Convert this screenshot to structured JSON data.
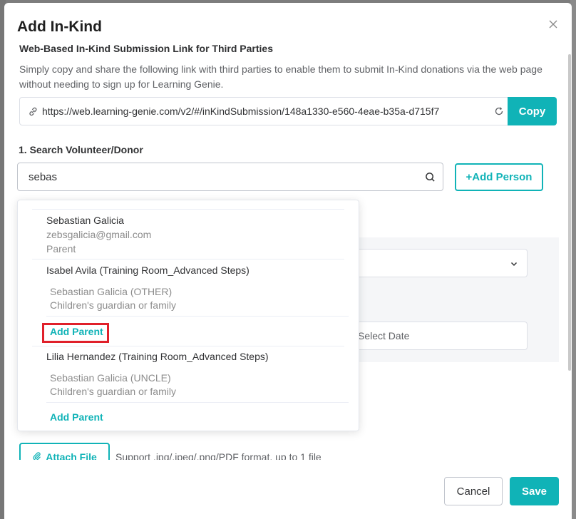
{
  "dialog": {
    "title": "Add In-Kind",
    "close_icon": "close-icon"
  },
  "link_section": {
    "title": "Web-Based In-Kind Submission Link for Third Parties",
    "description": "Simply copy and share the following link with third parties to enable them to submit In-Kind donations via the web page without needing to sign up for Learning Genie.",
    "url": "https://web.learning-genie.com/v2/#/inKindSubmission/148a1330-e560-4eae-b35a-d715f7",
    "copy_label": "Copy"
  },
  "search": {
    "label": "1. Search Volunteer/Donor",
    "value": "sebas",
    "add_person_label": "+Add Person"
  },
  "dropdown": {
    "results": [
      {
        "name": "Sebastian Galicia",
        "email": "zebsgalicia@gmail.com",
        "role": "Parent"
      },
      {
        "name": "Isabel Avila (Training Room_Advanced Steps)",
        "guardian_name": "Sebastian Galicia (OTHER)",
        "guardian_role": "Children's guardian or family",
        "add_parent_label": "Add Parent"
      },
      {
        "name": "Lilia Hernandez (Training Room_Advanced Steps)",
        "guardian_name": "Sebastian Galicia (UNCLE)",
        "guardian_role": "Children's guardian or family",
        "add_parent_label": "Add Parent"
      }
    ]
  },
  "form": {
    "date_placeholder": "Select Date",
    "attach_label": "Attach File",
    "support_text": "Support .jpg/.jpeg/.png/PDF format, up to 1 file"
  },
  "footer": {
    "cancel_label": "Cancel",
    "save_label": "Save"
  },
  "colors": {
    "accent": "#10b3b7",
    "highlight": "#e0202a"
  }
}
